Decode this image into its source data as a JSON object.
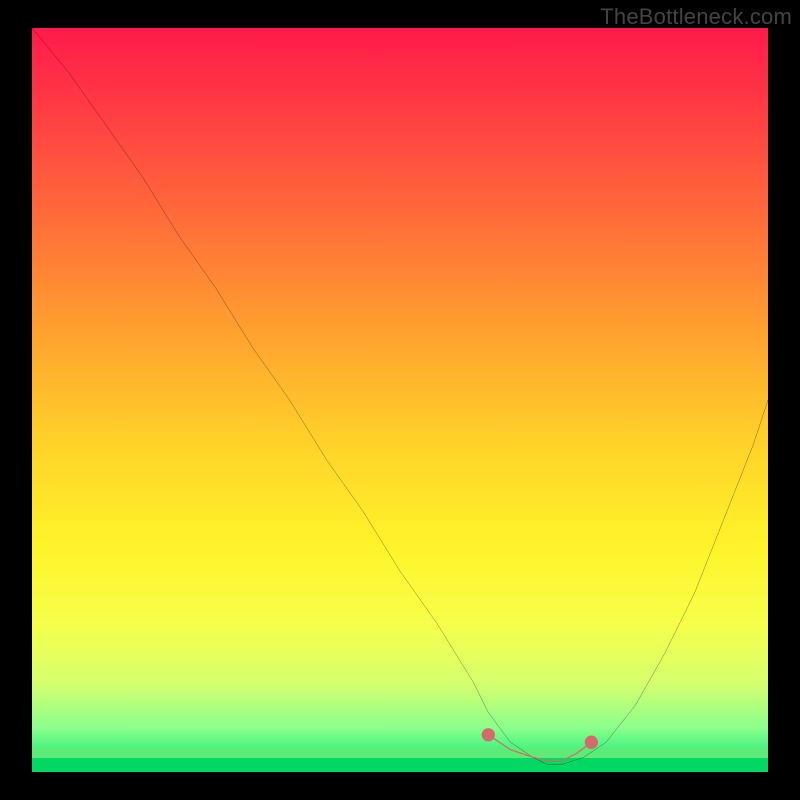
{
  "watermark": "TheBottleneck.com",
  "chart_data": {
    "type": "line",
    "title": "",
    "xlabel": "",
    "ylabel": "",
    "xlim": [
      0,
      100
    ],
    "ylim": [
      0,
      100
    ],
    "series": [
      {
        "name": "curve",
        "x": [
          0,
          5,
          10,
          15,
          20,
          25,
          30,
          35,
          40,
          45,
          50,
          55,
          60,
          62,
          65,
          68,
          70,
          72,
          75,
          78,
          82,
          86,
          90,
          94,
          98,
          100
        ],
        "y": [
          100,
          94,
          87,
          80,
          72,
          65,
          57,
          50,
          42,
          35,
          27,
          20,
          12,
          8,
          4,
          2,
          1,
          1,
          2,
          4,
          9,
          16,
          24,
          34,
          44,
          50
        ]
      }
    ],
    "highlight": {
      "name": "optimal-range",
      "x": [
        62,
        65,
        68,
        70,
        72,
        74,
        76
      ],
      "y": [
        5,
        3,
        2,
        1.5,
        1.5,
        2.5,
        4
      ],
      "color": "#d46a6a"
    },
    "gradient_stops": [
      {
        "pos": 0,
        "color": "#ff1a4b"
      },
      {
        "pos": 25,
        "color": "#ff6a3a"
      },
      {
        "pos": 55,
        "color": "#ffd02a"
      },
      {
        "pos": 80,
        "color": "#f6ff4a"
      },
      {
        "pos": 100,
        "color": "#00e676"
      }
    ]
  }
}
